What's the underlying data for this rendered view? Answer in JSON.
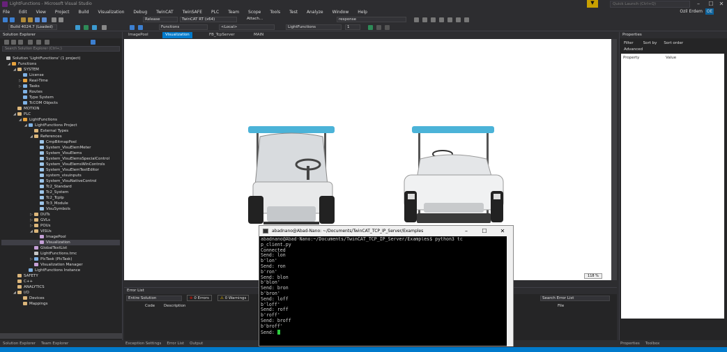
{
  "window": {
    "title": "LightFunctions - Microsoft Visual Studio",
    "quick_launch_placeholder": "Quick Launch (Ctrl+Q)",
    "user": "Ozil Erdem",
    "user_badge": "OE",
    "min": "–",
    "max": "☐",
    "close": "✕"
  },
  "menu": [
    "File",
    "Edit",
    "View",
    "Project",
    "Build",
    "Visualization",
    "Debug",
    "TwinCAT",
    "TwinSAFE",
    "PLC",
    "Team",
    "Scope",
    "Tools",
    "Test",
    "Analyze",
    "Window",
    "Help"
  ],
  "toolbar": {
    "config": "Release",
    "platform": "TwinCAT RT (x64)",
    "attach": "Attach...",
    "build_label": "Build 4024.7 (Loaded)",
    "functions": "Functions",
    "local": "<Local>",
    "project": "LightFunctions",
    "response": "response",
    "number": "1"
  },
  "solution_explorer": {
    "title": "Solution Explorer",
    "search_placeholder": "Search Solution Explorer (Ctrl+;)",
    "items": [
      {
        "label": "Solution 'LightFunctions' (1 project)",
        "depth": 0,
        "color": "#c5c5c5",
        "tri": ""
      },
      {
        "label": "Functions",
        "depth": 1,
        "color": "#e8a33d",
        "tri": "◢"
      },
      {
        "label": "SYSTEM",
        "depth": 2,
        "color": "#dcb67a",
        "tri": "◢"
      },
      {
        "label": "License",
        "depth": 3,
        "color": "#7fb2e5",
        "tri": ""
      },
      {
        "label": "Real-Time",
        "depth": 3,
        "color": "#e8a33d",
        "tri": "▷"
      },
      {
        "label": "Tasks",
        "depth": 3,
        "color": "#7fb2e5",
        "tri": "▷"
      },
      {
        "label": "Routes",
        "depth": 3,
        "color": "#7fb2e5",
        "tri": ""
      },
      {
        "label": "Type System",
        "depth": 3,
        "color": "#7fb2e5",
        "tri": ""
      },
      {
        "label": "TcCOM Objects",
        "depth": 3,
        "color": "#7fb2e5",
        "tri": ""
      },
      {
        "label": "MOTION",
        "depth": 2,
        "color": "#dcb67a",
        "tri": ""
      },
      {
        "label": "PLC",
        "depth": 2,
        "color": "#dcb67a",
        "tri": "◢"
      },
      {
        "label": "LightFunctions",
        "depth": 3,
        "color": "#e8a33d",
        "tri": "◢"
      },
      {
        "label": "LightFunctions Project",
        "depth": 4,
        "color": "#7fb2e5",
        "tri": "◢"
      },
      {
        "label": "External Types",
        "depth": 5,
        "color": "#dcb67a",
        "tri": ""
      },
      {
        "label": "References",
        "depth": 5,
        "color": "#dcb67a",
        "tri": "◢"
      },
      {
        "label": "CmpBitmapPool",
        "depth": 6,
        "color": "#9cc4e8",
        "tri": ""
      },
      {
        "label": "System_VisuElemMeter",
        "depth": 6,
        "color": "#9cc4e8",
        "tri": ""
      },
      {
        "label": "System_VisuElems",
        "depth": 6,
        "color": "#9cc4e8",
        "tri": ""
      },
      {
        "label": "System_VisuElemsSpecialControl",
        "depth": 6,
        "color": "#9cc4e8",
        "tri": ""
      },
      {
        "label": "System_VisuElemsWinControls",
        "depth": 6,
        "color": "#9cc4e8",
        "tri": ""
      },
      {
        "label": "System_VisuElemTextEditor",
        "depth": 6,
        "color": "#9cc4e8",
        "tri": ""
      },
      {
        "label": "system_visuinputs",
        "depth": 6,
        "color": "#9cc4e8",
        "tri": ""
      },
      {
        "label": "System_VisuNativeControl",
        "depth": 6,
        "color": "#9cc4e8",
        "tri": ""
      },
      {
        "label": "Tc2_Standard",
        "depth": 6,
        "color": "#9cc4e8",
        "tri": ""
      },
      {
        "label": "Tc2_System",
        "depth": 6,
        "color": "#9cc4e8",
        "tri": ""
      },
      {
        "label": "Tc2_TcpIp",
        "depth": 6,
        "color": "#9cc4e8",
        "tri": ""
      },
      {
        "label": "Tc3_Module",
        "depth": 6,
        "color": "#9cc4e8",
        "tri": ""
      },
      {
        "label": "VisuSymbols",
        "depth": 6,
        "color": "#9cc4e8",
        "tri": ""
      },
      {
        "label": "DUTs",
        "depth": 5,
        "color": "#dcb67a",
        "tri": "▷"
      },
      {
        "label": "GVLs",
        "depth": 5,
        "color": "#dcb67a",
        "tri": "▷"
      },
      {
        "label": "POUs",
        "depth": 5,
        "color": "#dcb67a",
        "tri": "▷"
      },
      {
        "label": "VISUs",
        "depth": 5,
        "color": "#dcb67a",
        "tri": "◢"
      },
      {
        "label": "ImagePool",
        "depth": 6,
        "color": "#c5a0d8",
        "tri": ""
      },
      {
        "label": "Visualization",
        "depth": 6,
        "color": "#c5a0d8",
        "tri": ""
      },
      {
        "label": "GlobalTextList",
        "depth": 5,
        "color": "#c5a0d8",
        "tri": ""
      },
      {
        "label": "LightFunctions.tmc",
        "depth": 5,
        "color": "#c5c5c5",
        "tri": ""
      },
      {
        "label": "PlcTask (PlcTask)",
        "depth": 5,
        "color": "#7fb2e5",
        "tri": "▷"
      },
      {
        "label": "Visualization Manager",
        "depth": 5,
        "color": "#c5a0d8",
        "tri": ""
      },
      {
        "label": "LightFunctions Instance",
        "depth": 4,
        "color": "#7fb2e5",
        "tri": ""
      },
      {
        "label": "SAFETY",
        "depth": 2,
        "color": "#dcb67a",
        "tri": ""
      },
      {
        "label": "C++",
        "depth": 2,
        "color": "#dcb67a",
        "tri": ""
      },
      {
        "label": "ANALYTICS",
        "depth": 2,
        "color": "#dcb67a",
        "tri": ""
      },
      {
        "label": "I/O",
        "depth": 2,
        "color": "#dcb67a",
        "tri": "◢"
      },
      {
        "label": "Devices",
        "depth": 3,
        "color": "#dcb67a",
        "tri": ""
      },
      {
        "label": "Mappings",
        "depth": 3,
        "color": "#dcb67a",
        "tri": ""
      }
    ]
  },
  "doc_tabs": [
    "ImagePool",
    "Visualization",
    "FB_TcpServer",
    "MAIN"
  ],
  "canvas": {
    "zoom": "118 %"
  },
  "properties": {
    "title": "Properties",
    "filter": "Filter",
    "sort_by": "Sort by",
    "sort_order": "Sort order",
    "advanced": "Advanced",
    "col_property": "Property",
    "col_value": "Value"
  },
  "error_list": {
    "title": "Error List",
    "scope": "Entire Solution",
    "errors": "0 Errors",
    "warnings": "0 Warnings",
    "search_placeholder": "Search Error List",
    "col_code": "Code",
    "col_desc": "Description",
    "col_file": "File"
  },
  "bottom_tabs_left": [
    "Solution Explorer",
    "Team Explorer"
  ],
  "bottom_tabs_mid": [
    "Exception Settings",
    "Error List",
    "Output"
  ],
  "bottom_tabs_right": [
    "Properties",
    "Toolbox"
  ],
  "terminal": {
    "title": "abadnano@Abad-Nano: ~/Documents/TwinCAT_TCP_IP_Server/Examples",
    "lines": [
      "abadnano@Abad-Nano:~/Documents/TwinCAT_TCP_IP_Server/Examples$ python3 tc",
      "p_client.py",
      "Connected",
      "Send: lon",
      "b'lon'",
      "Send: ron",
      "b'ron'",
      "Send: blon",
      "b'blon'",
      "Send: bron",
      "b'bron'",
      "Send: loff",
      "b'loff'",
      "Send: roff",
      "b'roff'",
      "Send: broff",
      "b'broff'"
    ],
    "prompt": "Send: "
  }
}
